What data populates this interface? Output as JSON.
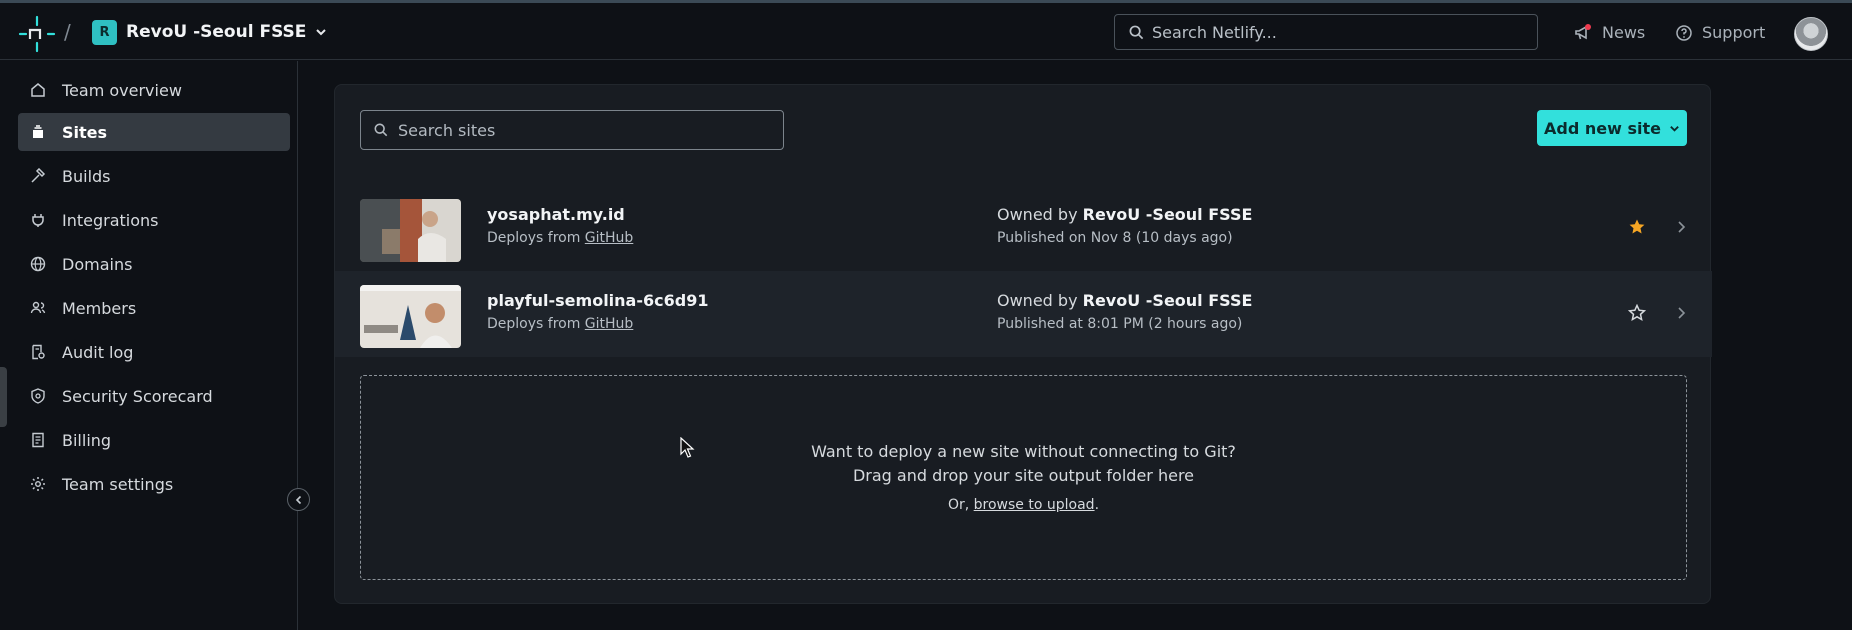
{
  "header": {
    "separator": "/",
    "team_badge": "R",
    "team_name": "RevoU -Seoul FSSE",
    "search_placeholder": "Search Netlify...",
    "news_label": "News",
    "support_label": "Support"
  },
  "sidebar": {
    "items": [
      {
        "label": "Team overview",
        "icon": "home-icon"
      },
      {
        "label": "Sites",
        "icon": "layers-icon",
        "active": true
      },
      {
        "label": "Builds",
        "icon": "hammer-icon"
      },
      {
        "label": "Integrations",
        "icon": "plug-icon"
      },
      {
        "label": "Domains",
        "icon": "globe-icon"
      },
      {
        "label": "Members",
        "icon": "users-icon"
      },
      {
        "label": "Audit log",
        "icon": "audit-icon"
      },
      {
        "label": "Security Scorecard",
        "icon": "shield-icon"
      },
      {
        "label": "Billing",
        "icon": "receipt-icon"
      },
      {
        "label": "Team settings",
        "icon": "gear-icon"
      }
    ]
  },
  "main": {
    "search_placeholder": "Search sites",
    "add_button": "Add new site",
    "sites": [
      {
        "name": "yosaphat.my.id",
        "deploy_prefix": "Deploys from ",
        "deploy_source": "GitHub",
        "owner_prefix": "Owned by ",
        "owner": "RevoU -Seoul FSSE",
        "published": "Published on Nov 8 (10 days ago)",
        "favorite": true
      },
      {
        "name": "playful-semolina-6c6d91",
        "deploy_prefix": "Deploys from ",
        "deploy_source": "GitHub",
        "owner_prefix": "Owned by ",
        "owner": "RevoU -Seoul FSSE",
        "published": "Published at 8:01 PM (2 hours ago)",
        "favorite": false
      }
    ],
    "dropzone": {
      "line1": "Want to deploy a new site without connecting to Git?",
      "line2": "Drag and drop your site output folder here",
      "prefix": "Or, ",
      "link": "browse to upload",
      "suffix": "."
    }
  },
  "colors": {
    "accent": "#32e0dc",
    "star_active": "#f5a524",
    "background": "#0e1116"
  }
}
